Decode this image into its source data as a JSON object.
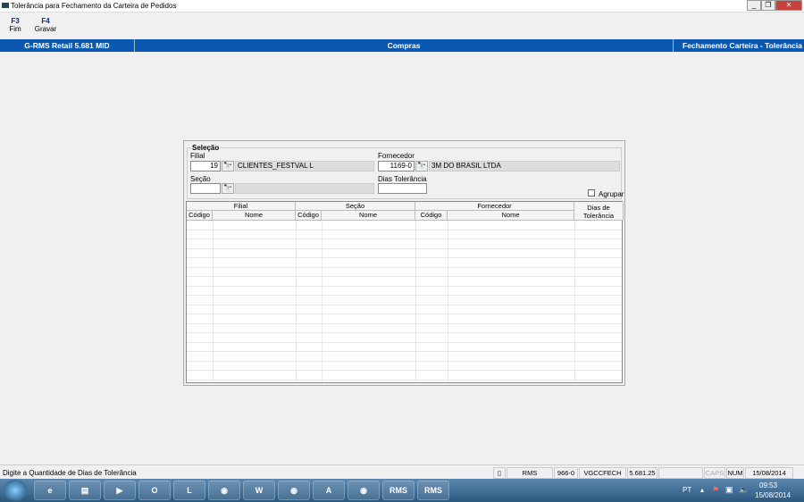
{
  "window": {
    "title": "Tolerância para Fechamento da Carteira de Pedidos",
    "minimize": "_",
    "restore": "❐",
    "close": "✕"
  },
  "toolbar": [
    {
      "key": "F3",
      "label": "Fim"
    },
    {
      "key": "F4",
      "label": "Gravar"
    }
  ],
  "header": {
    "left": "G-RMS Retail 5.681 MID",
    "center": "Compras",
    "right": "Fechamento Carteira - Tolerância"
  },
  "selecao": {
    "legend": "Seleção",
    "filial": {
      "label": "Filial",
      "code": "19",
      "name": "CLIENTES_FESTVAL L"
    },
    "fornecedor": {
      "label": "Fornecedor",
      "code": "1169-0",
      "name": "3M DO BRASIL LTDA"
    },
    "secao": {
      "label": "Seção",
      "code": "",
      "name": ""
    },
    "dias": {
      "label": "Dias Tolerância",
      "value": ""
    },
    "agrupar": {
      "label": "Agrupar",
      "checked": false
    }
  },
  "grid": {
    "groups": [
      "Filial",
      "Seção",
      "Fornecedor"
    ],
    "dias": "Dias de Tolerância",
    "codigo": "Código",
    "nome": "Nome",
    "rows": []
  },
  "status": {
    "message": "Digite a Quantidade de Dias de Tolerância",
    "cells": [
      "RMS",
      "966-0",
      "VGCCFECH",
      "5.681.25",
      "",
      "CAPS",
      "NUM",
      "15/08/2014"
    ]
  },
  "taskbar": {
    "lang": "PT",
    "time": "09:53",
    "date": "15/08/2014",
    "apps": [
      "ie",
      "explorer",
      "media-player",
      "outlook",
      "lync",
      "app",
      "word",
      "app",
      "acrobat",
      "app",
      "RMS",
      "RMS"
    ]
  }
}
